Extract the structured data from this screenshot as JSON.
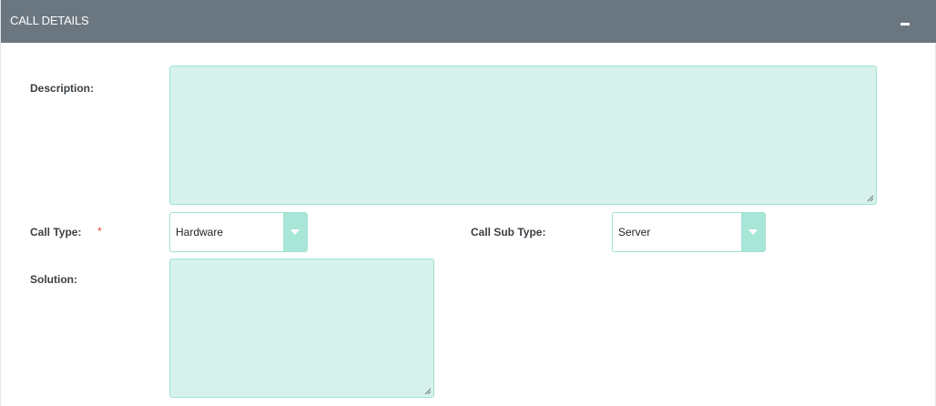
{
  "panel": {
    "title": "CALL DETAILS",
    "collapse_icon": "minus-icon"
  },
  "fields": {
    "description": {
      "label": "Description:",
      "value": ""
    },
    "call_type": {
      "label": "Call Type:",
      "required_marker": "*",
      "selected": "Hardware",
      "arrow_icon": "chevron-down-icon"
    },
    "call_sub_type": {
      "label": "Call Sub Type:",
      "selected": "Server",
      "arrow_icon": "chevron-down-icon"
    },
    "solution": {
      "label": "Solution:",
      "value": ""
    }
  },
  "colors": {
    "header_bg": "#6b7780",
    "field_bg": "#d7f2ec",
    "field_border": "#9fe3d2",
    "select_arrow_bg": "#a8e6d7",
    "required": "#e0453a"
  }
}
